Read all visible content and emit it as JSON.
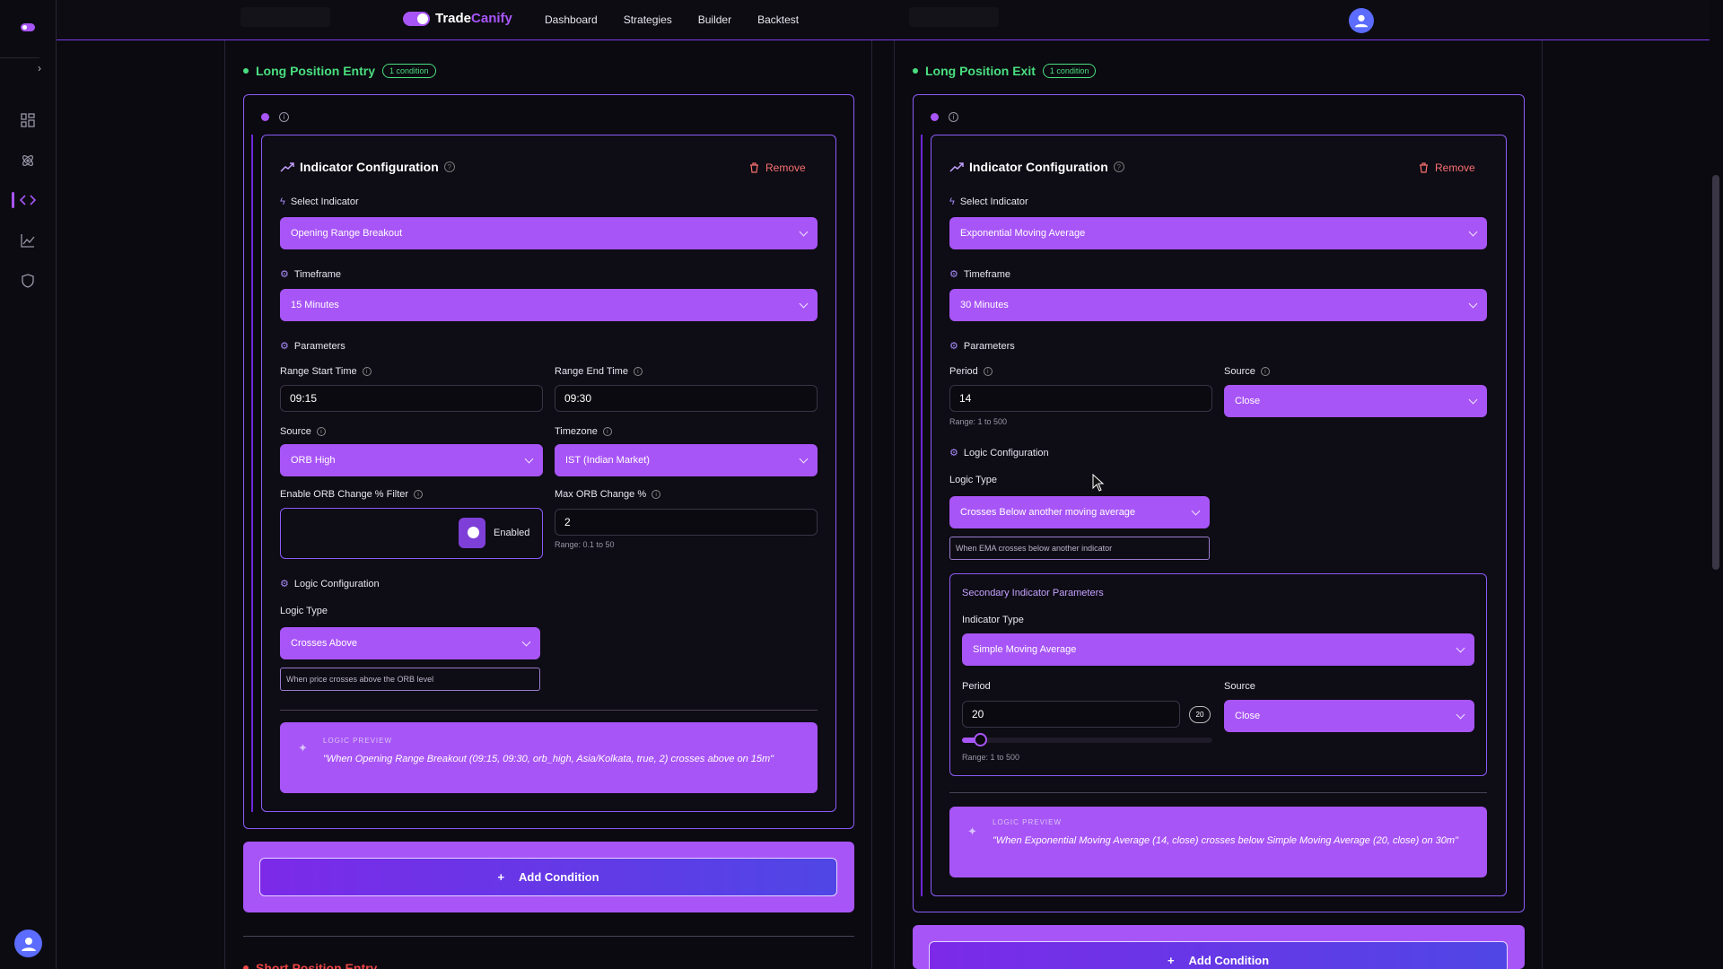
{
  "app": {
    "brand_prefix": "Trade",
    "brand_suffix": "Canify",
    "nav": [
      "Dashboard",
      "Strategies",
      "Builder",
      "Backtest"
    ]
  },
  "left": {
    "section_title": "Long Position Entry",
    "badge": "1 condition",
    "card_title": "Indicator Configuration",
    "remove_label": "Remove",
    "select_indicator_label": "Select Indicator",
    "indicator": "Opening Range Breakout",
    "timeframe_label": "Timeframe",
    "timeframe": "15 Minutes",
    "parameters_label": "Parameters",
    "range_start_label": "Range Start Time",
    "range_start": "09:15",
    "range_end_label": "Range End Time",
    "range_end": "09:30",
    "source_label": "Source",
    "source": "ORB High",
    "timezone_label": "Timezone",
    "timezone": "IST (Indian Market)",
    "orb_filter_label": "Enable ORB Change % Filter",
    "orb_filter_state": "Enabled",
    "orb_filter_enabled": true,
    "max_orb_label": "Max ORB Change %",
    "max_orb": "2",
    "max_orb_hint": "Range: 0.1 to 50",
    "logic_config_label": "Logic Configuration",
    "logic_type_label": "Logic Type",
    "logic_type": "Crosses Above",
    "logic_desc": "When price crosses above the ORB level",
    "preview_head": "LOGIC PREVIEW",
    "preview_text": "\"When Opening Range Breakout (09:15, 09:30, orb_high, Asia/Kolkata, true, 2) crosses above on 15m\"",
    "add_condition": "Add Condition",
    "next_section": "Short Position Entry"
  },
  "right": {
    "section_title": "Long Position Exit",
    "badge": "1 condition",
    "card_title": "Indicator Configuration",
    "remove_label": "Remove",
    "select_indicator_label": "Select Indicator",
    "indicator": "Exponential Moving Average",
    "timeframe_label": "Timeframe",
    "timeframe": "30 Minutes",
    "parameters_label": "Parameters",
    "period_label": "Period",
    "period": "14",
    "period_hint": "Range: 1 to 500",
    "source_label": "Source",
    "source": "Close",
    "logic_config_label": "Logic Configuration",
    "logic_type_label": "Logic Type",
    "logic_type": "Crosses Below another moving average",
    "logic_desc": "When EMA crosses below another indicator",
    "secondary_title": "Secondary Indicator Parameters",
    "indicator_type_label": "Indicator Type",
    "indicator_type": "Simple Moving Average",
    "sec_period_label": "Period",
    "sec_period": "20",
    "sec_period_badge": "20",
    "sec_period_slider_fraction": 0.04,
    "sec_source_label": "Source",
    "sec_source": "Close",
    "sec_period_hint": "Range: 1 to 500",
    "preview_head": "LOGIC PREVIEW",
    "preview_text": "\"When Exponential Moving Average (14, close) crosses below Simple Moving Average (20, close) on 30m\"",
    "add_condition": "Add Condition"
  },
  "colors": {
    "accent": "#a855f7",
    "success": "#4ade80",
    "danger": "#f87171"
  }
}
